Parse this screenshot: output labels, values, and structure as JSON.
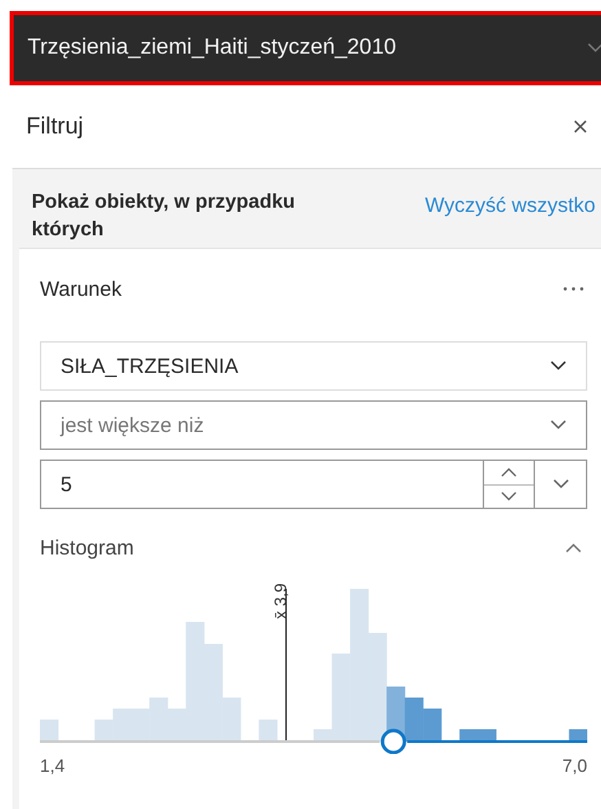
{
  "layer_selector": {
    "title": "Trzęsienia_ziemi_Haiti_styczeń_2010"
  },
  "panel": {
    "title": "Filtruj"
  },
  "filter": {
    "heading": "Pokaż obiekty, w przypadku których",
    "clear_link": "Wyczyść wszystko"
  },
  "condition": {
    "title": "Warunek",
    "field": {
      "value": "SIŁA_TRZĘSIENIA"
    },
    "operator": {
      "value": "jest większe niż"
    },
    "value_input": {
      "value": "5"
    },
    "histogram": {
      "title": "Histogram",
      "expanded": true,
      "mean_label": "x̄ 3,9",
      "min_label": "1,4",
      "max_label": "7,0",
      "slider": {
        "level": 0.646
      }
    }
  }
}
